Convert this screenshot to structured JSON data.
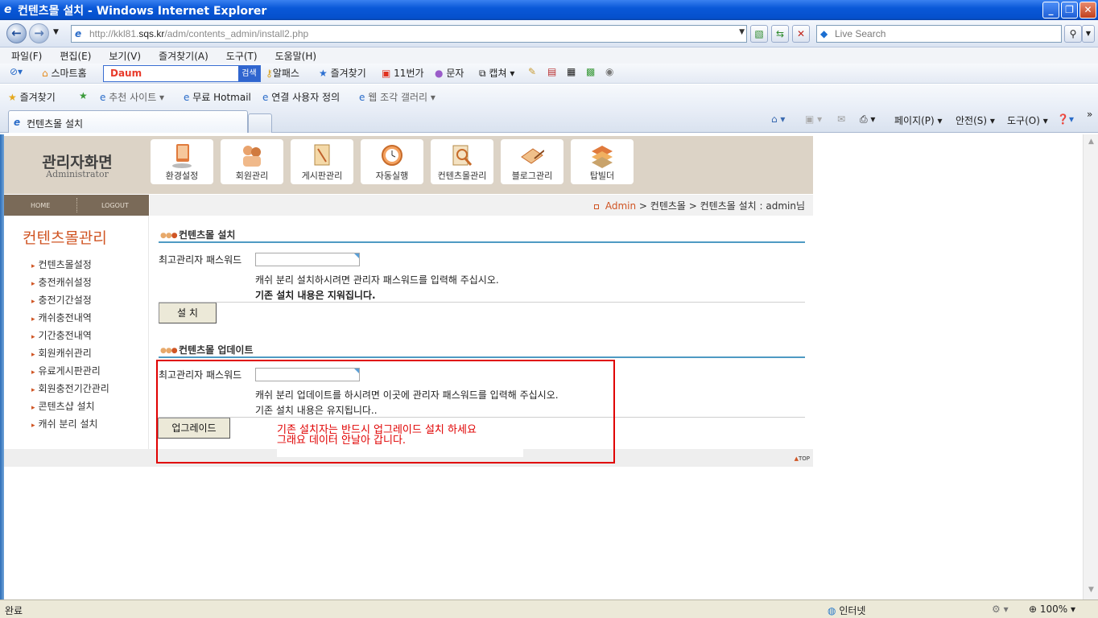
{
  "window": {
    "title": "컨텐츠몰 설치 - Windows Internet Explorer"
  },
  "address": {
    "url_gray_prefix": "http://kkl81.",
    "url_host": "sqs.kr",
    "url_path": "/adm/contents_admin/install2.php"
  },
  "search": {
    "placeholder": "Live Search"
  },
  "menu": [
    "파일(F)",
    "편집(E)",
    "보기(V)",
    "즐겨찾기(A)",
    "도구(T)",
    "도움말(H)"
  ],
  "toolbar": {
    "smarthome": "스마트홈",
    "daum_logo": "Daum",
    "daum_btn": "검색",
    "alpass": "알패스",
    "favorites": "즐겨찾기",
    "eleven": "11번가",
    "sms": "문자",
    "capture": "캡쳐"
  },
  "favbar": {
    "favorites": "즐겨찾기",
    "recommended": "추천 사이트",
    "hotmail": "무료 Hotmail",
    "custom_links": "연결 사용자 정의",
    "webslice": "웹 조각 갤러리"
  },
  "tab": {
    "title": "컨텐츠몰 설치"
  },
  "cmdbar": {
    "page": "페이지(P)",
    "safety": "안전(S)",
    "tools": "도구(O)"
  },
  "site": {
    "logo_title": "관리자화면",
    "logo_sub": "Administrator",
    "menu": [
      "환경설정",
      "회원관리",
      "게시판관리",
      "자동실행",
      "컨텐츠몰관리",
      "블로그관리",
      "탑빌더"
    ],
    "home": "HOME",
    "logout": "LOGOUT",
    "breadcrumb": {
      "admin": "Admin",
      "rest": " > 컨텐츠몰 > 컨텐츠몰 설치 : admin님"
    },
    "left_title": "컨텐츠몰관리",
    "left_items": [
      "컨텐츠몰설정",
      "충전캐쉬설정",
      "충전기간설정",
      "캐쉬충전내역",
      "기간충전내역",
      "회원캐쉬관리",
      "유료게시판관리",
      "회원충전기간관리",
      "콘텐츠샵 설치",
      "캐쉬 분리 설치"
    ],
    "install": {
      "title": "컨텐츠몰 설치",
      "label": "최고관리자 패스워드",
      "desc1": "캐쉬 분리 설치하시려면 관리자 패스워드를 입력해 주십시오.",
      "desc2": "기존 설치 내용은 지워집니다.",
      "button": "설 치"
    },
    "update": {
      "title": "컨텐츠몰 업데이트",
      "label": "최고관리자 패스워드",
      "desc1": "캐쉬 분리 업데이트를 하시려면 이곳에 관리자 패스워드를 입력해 주십시오.",
      "desc2": "기존 설치 내용은 유지됩니다..",
      "button": "업그레이드"
    },
    "note1": "기존 설치자는 반드시 업그레이드 설치 하세요",
    "note2": "그래요 데이터 안날아 갑니다.",
    "top": "TOP"
  },
  "status": {
    "left": "완료",
    "zone": "인터넷",
    "zoom": "100%"
  },
  "colors": {
    "accent": "#d05524",
    "annotation": "#e00000",
    "header_bg": "#dcd3c6",
    "section_line": "#4e9ac3"
  }
}
